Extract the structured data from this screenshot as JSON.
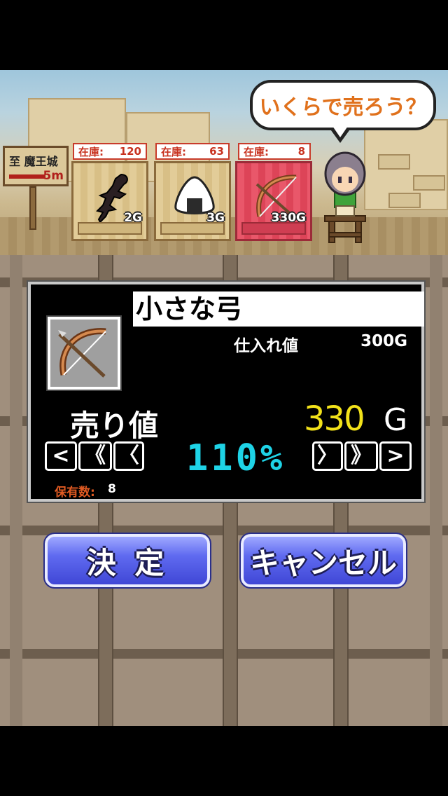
{
  "scene": {
    "sign_text": "至 魔王城",
    "sign_distance": "5m",
    "speech_bubble": "いくらで売ろう？",
    "shelf": [
      {
        "stock_label": "在庫:",
        "stock": "120",
        "price": "2G",
        "icon": "lizard-icon"
      },
      {
        "stock_label": "在庫:",
        "stock": "63",
        "price": "3G",
        "icon": "rice-ball-icon"
      },
      {
        "stock_label": "在庫:",
        "stock": "8",
        "price": "330G",
        "icon": "bow-icon",
        "selected": true
      }
    ]
  },
  "panel": {
    "item_name": "小さな弓",
    "cost_label": "仕入れ値",
    "cost_value": "300G",
    "sell_label": "売り値",
    "sell_price": "330",
    "sell_unit": "G",
    "percent": "110%",
    "decrease_buttons": [
      "<",
      "《",
      "〈"
    ],
    "increase_buttons": [
      "〉",
      "》",
      ">"
    ],
    "owned_label": "保有数:",
    "owned_value": "8"
  },
  "buttons": {
    "confirm": "決 定",
    "cancel": "キャンセル"
  },
  "colors": {
    "price_yellow": "#f2e21a",
    "percent_cyan": "#1ed3e6",
    "button_blue": "#4f5ae6",
    "stock_red": "#c8321f"
  }
}
